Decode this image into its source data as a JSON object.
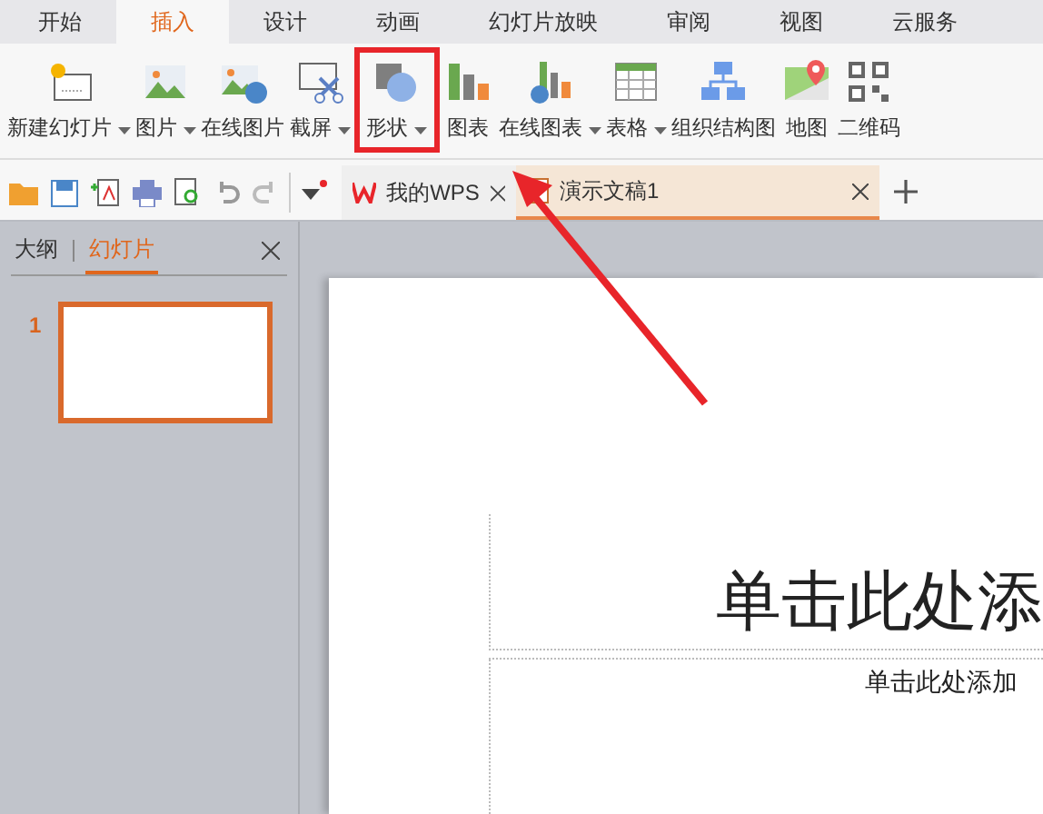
{
  "ribbon_tabs": [
    {
      "label": "开始",
      "selected": false
    },
    {
      "label": "插入",
      "selected": true
    },
    {
      "label": "设计",
      "selected": false
    },
    {
      "label": "动画",
      "selected": false
    },
    {
      "label": "幻灯片放映",
      "selected": false
    },
    {
      "label": "审阅",
      "selected": false
    },
    {
      "label": "视图",
      "selected": false
    },
    {
      "label": "云服务",
      "selected": false
    }
  ],
  "ribbon_buttons": [
    {
      "label": "新建幻灯片",
      "dropdown": true,
      "highlighted": false
    },
    {
      "label": "图片",
      "dropdown": true,
      "highlighted": false
    },
    {
      "label": "在线图片",
      "dropdown": false,
      "highlighted": false
    },
    {
      "label": "截屏",
      "dropdown": true,
      "highlighted": false
    },
    {
      "label": "形状",
      "dropdown": true,
      "highlighted": true
    },
    {
      "label": "图表",
      "dropdown": false,
      "highlighted": false
    },
    {
      "label": "在线图表",
      "dropdown": true,
      "highlighted": false
    },
    {
      "label": "表格",
      "dropdown": true,
      "highlighted": false
    },
    {
      "label": "组织结构图",
      "dropdown": false,
      "highlighted": false
    },
    {
      "label": "地图",
      "dropdown": false,
      "highlighted": false
    },
    {
      "label": "二维码",
      "dropdown": false,
      "highlighted": false
    }
  ],
  "document_tabs": [
    {
      "label": "我的WPS",
      "selected": false
    },
    {
      "label": "演示文稿1",
      "selected": true
    }
  ],
  "side_panel": {
    "tabs": [
      {
        "label": "大纲",
        "selected": false
      },
      {
        "label": "幻灯片",
        "selected": true
      }
    ],
    "slides": [
      {
        "number": "1",
        "selected": true
      }
    ]
  },
  "slide": {
    "title": "单击此处添",
    "subtitle": "单击此处添加"
  }
}
